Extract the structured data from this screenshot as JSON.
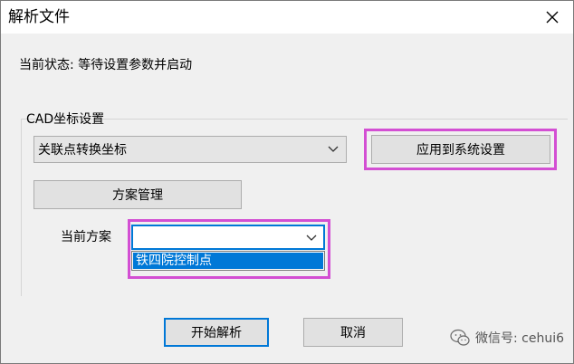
{
  "window": {
    "title": "解析文件"
  },
  "status": {
    "text": "当前状态: 等待设置参数并启动"
  },
  "cad_group": {
    "label": "CAD坐标设置",
    "coord_combo_value": "关联点转换坐标",
    "apply_button": "应用到系统设置",
    "scheme_button": "方案管理",
    "plan_label": "当前方案",
    "plan_combo_value": "",
    "dropdown_options": [
      "铁四院控制点"
    ]
  },
  "footer": {
    "start_button": "开始解析",
    "cancel_button": "取消"
  },
  "watermark": {
    "text": "微信号: cehui6"
  },
  "colors": {
    "highlight": "#d34fd3",
    "accent": "#0078d7",
    "dialog_bg": "#f0f0f0"
  },
  "icons": {
    "close": "close-icon",
    "chevron": "chevron-down-icon",
    "wechat": "wechat-icon"
  }
}
